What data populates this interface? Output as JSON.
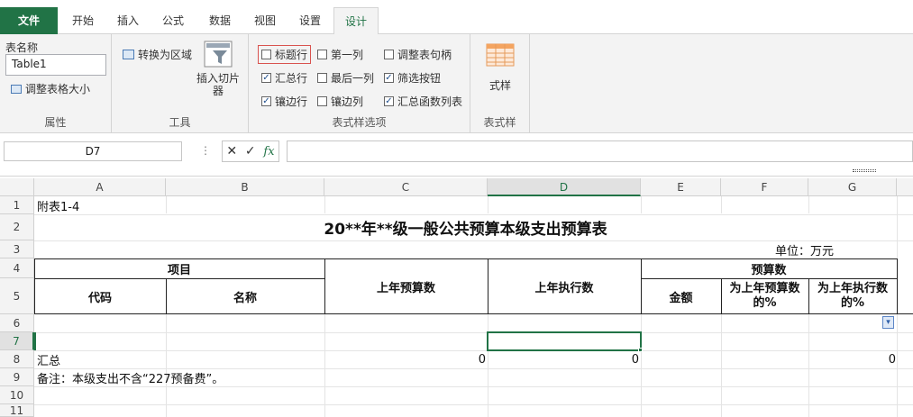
{
  "tabs": [
    "文件",
    "开始",
    "插入",
    "公式",
    "数据",
    "视图",
    "设置",
    "设计"
  ],
  "ribbon": {
    "props": {
      "table_name_label": "表名称",
      "table_name": "Table1",
      "resize": "调整表格大小",
      "group": "属性"
    },
    "tools": {
      "convert": "转换为区域",
      "slicer": "插入切片器",
      "group": "工具"
    },
    "options": {
      "header_row": "标题行",
      "total_row": "汇总行",
      "banded_rows": "镶边行",
      "first_col": "第一列",
      "last_col": "最后一列",
      "banded_cols": "镶边列",
      "handle": "调整表句柄",
      "filter_btn": "筛选按钮",
      "total_func": "汇总函数列表",
      "group": "表式样选项"
    },
    "styles": {
      "label": "式样",
      "group": "表式样"
    }
  },
  "formula_bar": {
    "name_box": "D7",
    "fx": "fx",
    "value": ""
  },
  "columns": [
    "A",
    "B",
    "C",
    "D",
    "E",
    "F",
    "G"
  ],
  "rows": [
    "1",
    "2",
    "3",
    "4",
    "5",
    "6",
    "7",
    "8",
    "9",
    "10",
    "11"
  ],
  "sheet": {
    "a1": "附表1-4",
    "title": "20**年**级一般公共预算本级支出预算表",
    "unit": "单位：万元",
    "item": "项目",
    "code": "代码",
    "name": "名称",
    "prev_budget": "上年预算数",
    "prev_exec": "上年执行数",
    "budget": "预算数",
    "amount": "金额",
    "pct_budget": "为上年预算数的%",
    "pct_exec": "为上年执行数的%",
    "total": "汇总",
    "c8": "0",
    "d8": "0",
    "g8": "0",
    "note": "备注：本级支出不含“227预备费”。"
  }
}
